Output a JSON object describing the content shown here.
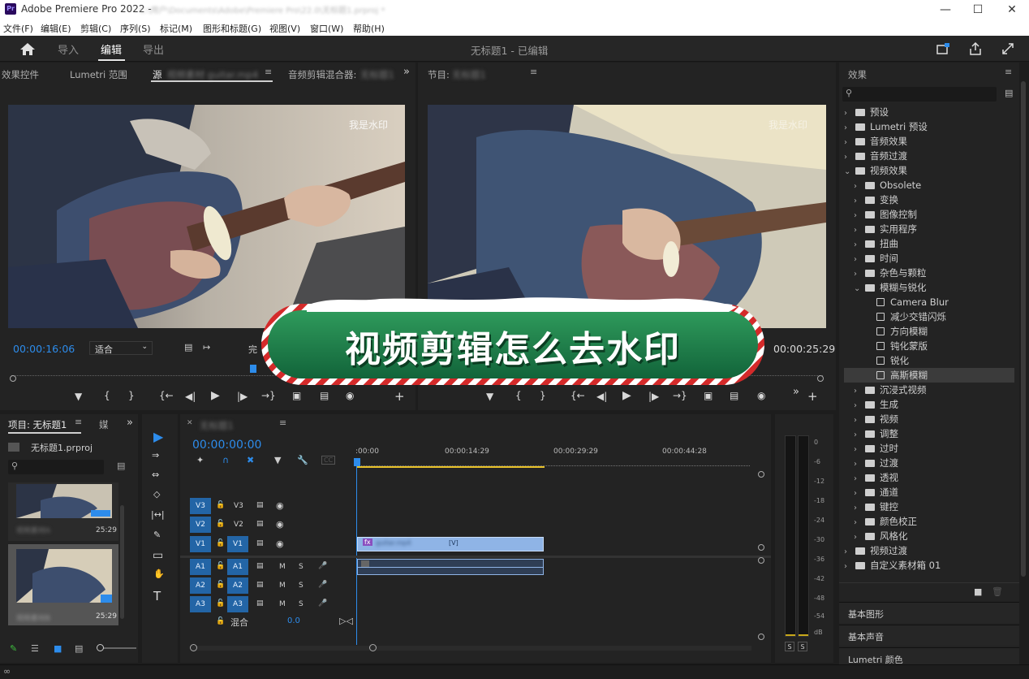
{
  "app": {
    "title": "Adobe Premiere Pro 2022 -",
    "path_blurred": "C:\\用户\\Documents\\Adobe\\Premiere Pro\\22.0\\无标题1.prproj *"
  },
  "menu": [
    "文件(F)",
    "编辑(E)",
    "剪辑(C)",
    "序列(S)",
    "标记(M)",
    "图形和标题(G)",
    "视图(V)",
    "窗口(W)",
    "帮助(H)"
  ],
  "workspace": {
    "tabs": [
      "导入",
      "编辑",
      "导出"
    ],
    "active": "编辑",
    "doc_title": "无标题1 - 已编辑"
  },
  "source_panel": {
    "tabs": [
      "效果控件",
      "Lumetri 范围",
      "源",
      "音频剪辑混合器:"
    ],
    "source_clip_blurred": "视频素材 guitar.mp4",
    "mixer_blurred": "无标题1",
    "watermark": "我是水印",
    "timecode": "00:00:16:06",
    "fit": "适合",
    "res": "完"
  },
  "program_panel": {
    "label": "节目:",
    "seq_blurred": "无标题1",
    "watermark": "我是水印",
    "timecode": "00:00:25:29"
  },
  "banner": "视频剪辑怎么去水印",
  "project_panel": {
    "tabs": [
      "项目: 无标题1",
      "媒"
    ],
    "file": "无标题1.prproj",
    "items": [
      {
        "name_blurred": "视频素材A",
        "duration": "25:29"
      },
      {
        "name_blurred": "视频素材B",
        "duration": "25:29"
      }
    ]
  },
  "timeline": {
    "seq_tab_blurred": "无标题1",
    "timecode": "00:00:00:00",
    "ruler": [
      ":00:00",
      "00:00:14:29",
      "00:00:29:29",
      "00:00:44:28"
    ],
    "video_tracks": [
      {
        "src": "V3",
        "name": "V3"
      },
      {
        "src": "V2",
        "name": "V2"
      },
      {
        "src": "V1",
        "name": "V1"
      }
    ],
    "audio_tracks": [
      {
        "src": "A1",
        "name": "A1"
      },
      {
        "src": "A2",
        "name": "A2"
      },
      {
        "src": "A3",
        "name": "A3"
      }
    ],
    "m": "M",
    "s": "S",
    "mix_label": "混合",
    "mix_value": "0.0",
    "clip_blurred": "guitar.mp4",
    "clip_tag": "[V]",
    "fx": "fx"
  },
  "meter": {
    "scale": [
      "0",
      "-6",
      "-12",
      "-18",
      "-24",
      "-30",
      "-36",
      "-42",
      "-48",
      "-54",
      "dB"
    ],
    "solo": [
      "S",
      "S"
    ]
  },
  "effects_panel": {
    "title": "效果",
    "tree": [
      {
        "label": "预设",
        "level": 0,
        "kind": "folder",
        "open": false
      },
      {
        "label": "Lumetri 预设",
        "level": 0,
        "kind": "folder",
        "open": false
      },
      {
        "label": "音频效果",
        "level": 0,
        "kind": "folder",
        "open": false
      },
      {
        "label": "音频过渡",
        "level": 0,
        "kind": "folder",
        "open": false
      },
      {
        "label": "视频效果",
        "level": 0,
        "kind": "folder",
        "open": true
      },
      {
        "label": "Obsolete",
        "level": 1,
        "kind": "folder",
        "open": false
      },
      {
        "label": "变换",
        "level": 1,
        "kind": "folder",
        "open": false
      },
      {
        "label": "图像控制",
        "level": 1,
        "kind": "folder",
        "open": false
      },
      {
        "label": "实用程序",
        "level": 1,
        "kind": "folder",
        "open": false
      },
      {
        "label": "扭曲",
        "level": 1,
        "kind": "folder",
        "open": false
      },
      {
        "label": "时间",
        "level": 1,
        "kind": "folder",
        "open": false
      },
      {
        "label": "杂色与颗粒",
        "level": 1,
        "kind": "folder",
        "open": false
      },
      {
        "label": "模糊与锐化",
        "level": 1,
        "kind": "folder",
        "open": true
      },
      {
        "label": "Camera Blur",
        "level": 2,
        "kind": "effect"
      },
      {
        "label": "减少交错闪烁",
        "level": 2,
        "kind": "effect"
      },
      {
        "label": "方向模糊",
        "level": 2,
        "kind": "effect"
      },
      {
        "label": "钝化蒙版",
        "level": 2,
        "kind": "effect"
      },
      {
        "label": "锐化",
        "level": 2,
        "kind": "effect"
      },
      {
        "label": "高斯模糊",
        "level": 2,
        "kind": "effect",
        "selected": true
      },
      {
        "label": "沉浸式视频",
        "level": 1,
        "kind": "folder",
        "open": false
      },
      {
        "label": "生成",
        "level": 1,
        "kind": "folder",
        "open": false
      },
      {
        "label": "视频",
        "level": 1,
        "kind": "folder",
        "open": false
      },
      {
        "label": "调整",
        "level": 1,
        "kind": "folder",
        "open": false
      },
      {
        "label": "过时",
        "level": 1,
        "kind": "folder",
        "open": false
      },
      {
        "label": "过渡",
        "level": 1,
        "kind": "folder",
        "open": false
      },
      {
        "label": "透视",
        "level": 1,
        "kind": "folder",
        "open": false
      },
      {
        "label": "通道",
        "level": 1,
        "kind": "folder",
        "open": false
      },
      {
        "label": "键控",
        "level": 1,
        "kind": "folder",
        "open": false
      },
      {
        "label": "颜色校正",
        "level": 1,
        "kind": "folder",
        "open": false
      },
      {
        "label": "风格化",
        "level": 1,
        "kind": "folder",
        "open": false
      },
      {
        "label": "视频过渡",
        "level": 0,
        "kind": "folder",
        "open": false
      },
      {
        "label": "自定义素材箱 01",
        "level": 0,
        "kind": "folder",
        "open": false
      }
    ],
    "sections": [
      "基本图形",
      "基本声音",
      "Lumetri 颜色"
    ]
  },
  "colors": {
    "accent": "#2d8ceb",
    "track": "#2365a6",
    "clip": "#8fb4e6",
    "banner": "#1f7a4a"
  }
}
